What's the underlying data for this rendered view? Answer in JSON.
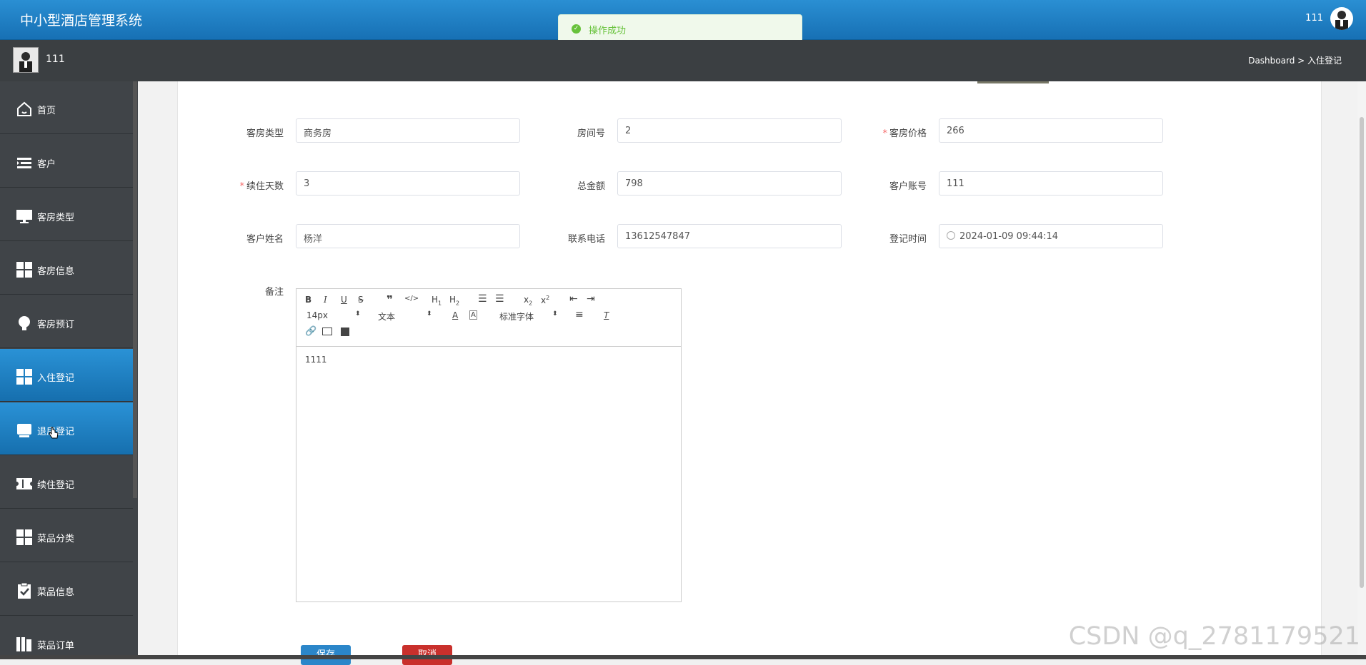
{
  "header": {
    "app_title": "中小型酒店管理系统",
    "user": "111"
  },
  "toast": {
    "message": "操作成功"
  },
  "subheader": {
    "user": "111",
    "breadcrumb": "Dashboard > 入住登记"
  },
  "sidebar": {
    "items": [
      {
        "label": "首页",
        "icon": "home-icon"
      },
      {
        "label": "客户",
        "icon": "list-icon"
      },
      {
        "label": "客房类型",
        "icon": "monitor-icon"
      },
      {
        "label": "客房信息",
        "icon": "grid-icon"
      },
      {
        "label": "客房预订",
        "icon": "bulb-icon"
      },
      {
        "label": "入住登记",
        "icon": "grid-icon"
      },
      {
        "label": "退房登记",
        "icon": "inbox-icon"
      },
      {
        "label": "续住登记",
        "icon": "ticket-icon"
      },
      {
        "label": "菜品分类",
        "icon": "grid-icon"
      },
      {
        "label": "菜品信息",
        "icon": "clipboard-check-icon"
      },
      {
        "label": "菜品订单",
        "icon": "book-icon"
      }
    ]
  },
  "form": {
    "room_type": {
      "label": "客房类型",
      "value": "商务房"
    },
    "room_no": {
      "label": "房间号",
      "value": "2"
    },
    "room_price": {
      "label": "客房价格",
      "value": "266"
    },
    "stay_days": {
      "label": "续住天数",
      "value": "3"
    },
    "total": {
      "label": "总金额",
      "value": "798"
    },
    "account": {
      "label": "客户账号",
      "value": "111"
    },
    "name": {
      "label": "客户姓名",
      "value": "杨洋"
    },
    "phone": {
      "label": "联系电话",
      "value": "13612547847"
    },
    "time": {
      "label": "登记时间",
      "value": "2024-01-09 09:44:14"
    },
    "remark": {
      "label": "备注",
      "value": "1111"
    }
  },
  "editor": {
    "font_size": "14px",
    "paragraph": "文本",
    "font_family": "标准字体"
  },
  "buttons": {
    "save": "保存",
    "cancel": "取消"
  },
  "watermark": "CSDN @q_2781179521"
}
